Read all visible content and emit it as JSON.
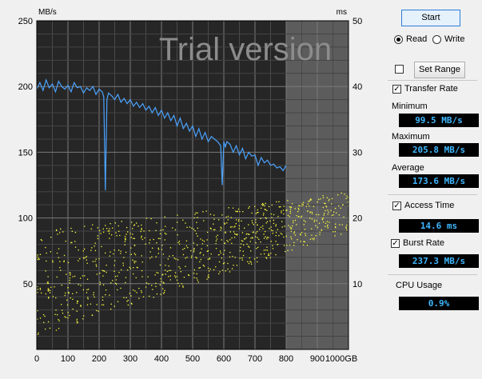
{
  "watermark": "Trial version",
  "chart_data": {
    "type": "line",
    "left_axis_unit": "MB/s",
    "right_axis_unit": "ms",
    "left_ticks": [
      "250",
      "200",
      "150",
      "100",
      "50"
    ],
    "right_ticks": [
      "50",
      "40",
      "30",
      "20",
      "10"
    ],
    "x_ticks": [
      "0",
      "100",
      "200",
      "300",
      "400",
      "500",
      "600",
      "700",
      "800",
      "900",
      "1000GB"
    ],
    "ylim_left": [
      0,
      250
    ],
    "ylim_right": [
      0,
      50
    ],
    "xlim": [
      0,
      1000
    ],
    "tested_until_gb": 800,
    "series": [
      {
        "name": "Transfer Rate",
        "color": "#4aa3ff",
        "x": [
          0,
          10,
          20,
          30,
          40,
          50,
          60,
          70,
          80,
          90,
          100,
          110,
          120,
          130,
          140,
          150,
          160,
          170,
          180,
          190,
          200,
          210,
          215,
          220,
          225,
          230,
          240,
          250,
          260,
          270,
          280,
          290,
          300,
          310,
          320,
          330,
          340,
          350,
          360,
          370,
          380,
          390,
          400,
          410,
          420,
          430,
          440,
          450,
          460,
          470,
          480,
          490,
          500,
          510,
          520,
          530,
          540,
          550,
          560,
          570,
          580,
          590,
          595,
          600,
          605,
          610,
          620,
          630,
          640,
          650,
          660,
          670,
          680,
          690,
          700,
          710,
          720,
          730,
          740,
          750,
          760,
          770,
          780,
          790,
          800
        ],
        "y": [
          198,
          203,
          197,
          205,
          199,
          202,
          196,
          204,
          200,
          198,
          201,
          196,
          203,
          199,
          200,
          195,
          199,
          197,
          200,
          194,
          198,
          196,
          192,
          121,
          190,
          195,
          193,
          190,
          194,
          188,
          191,
          187,
          190,
          185,
          188,
          184,
          187,
          182,
          185,
          180,
          184,
          178,
          182,
          176,
          180,
          174,
          178,
          170,
          176,
          168,
          172,
          166,
          170,
          162,
          168,
          160,
          165,
          158,
          162,
          160,
          158,
          155,
          125,
          158,
          154,
          158,
          156,
          150,
          155,
          148,
          153,
          145,
          150,
          147,
          148,
          140,
          146,
          142,
          144,
          140,
          141,
          138,
          139,
          136,
          140
        ]
      }
    ],
    "access_time_scatter": {
      "name": "Access Time",
      "color": "#ffff40",
      "x_range": [
        0,
        1000
      ],
      "ms_range_start": [
        2,
        18
      ],
      "ms_range_end": [
        18,
        24
      ]
    }
  },
  "controls": {
    "start_label": "Start",
    "read_label": "Read",
    "write_label": "Write",
    "set_range_label": "Set Range",
    "transfer_rate_label": "Transfer Rate",
    "minimum_label": "Minimum",
    "minimum_value": "99.5 MB/s",
    "maximum_label": "Maximum",
    "maximum_value": "205.8 MB/s",
    "average_label": "Average",
    "average_value": "173.6 MB/s",
    "access_time_label": "Access Time",
    "access_time_value": "14.6 ms",
    "burst_rate_label": "Burst Rate",
    "burst_rate_value": "237.3 MB/s",
    "cpu_usage_label": "CPU Usage",
    "cpu_usage_value": "0.9%"
  }
}
